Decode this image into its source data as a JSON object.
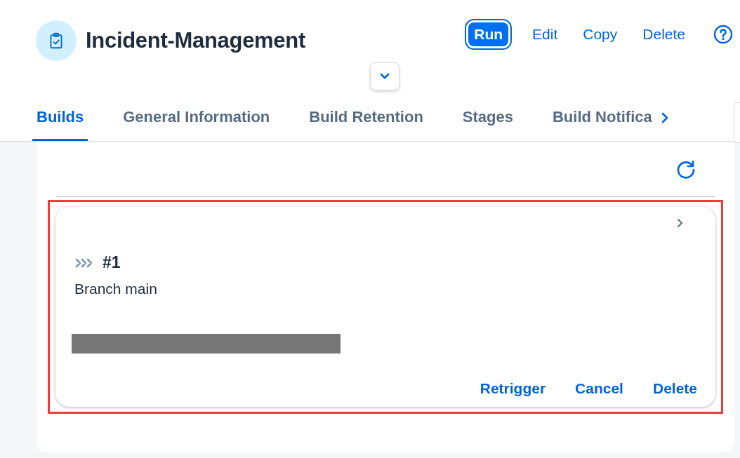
{
  "header": {
    "title": "Incident-Management",
    "actions": [
      {
        "label": "Run",
        "kind": "emphasized"
      },
      {
        "label": "Edit",
        "kind": "transparent"
      },
      {
        "label": "Copy",
        "kind": "transparent"
      },
      {
        "label": "Delete",
        "kind": "transparent"
      }
    ]
  },
  "tabs": [
    {
      "label": "Builds",
      "selected": true
    },
    {
      "label": "General Information",
      "selected": false
    },
    {
      "label": "Build Retention",
      "selected": false
    },
    {
      "label": "Stages",
      "selected": false
    },
    {
      "label": "Build Notifica",
      "selected": false
    }
  ],
  "builds": [
    {
      "number": "#1",
      "branch": "Branch main",
      "highlighted": true,
      "actions": [
        "Retrigger",
        "Cancel",
        "Delete"
      ]
    }
  ]
}
